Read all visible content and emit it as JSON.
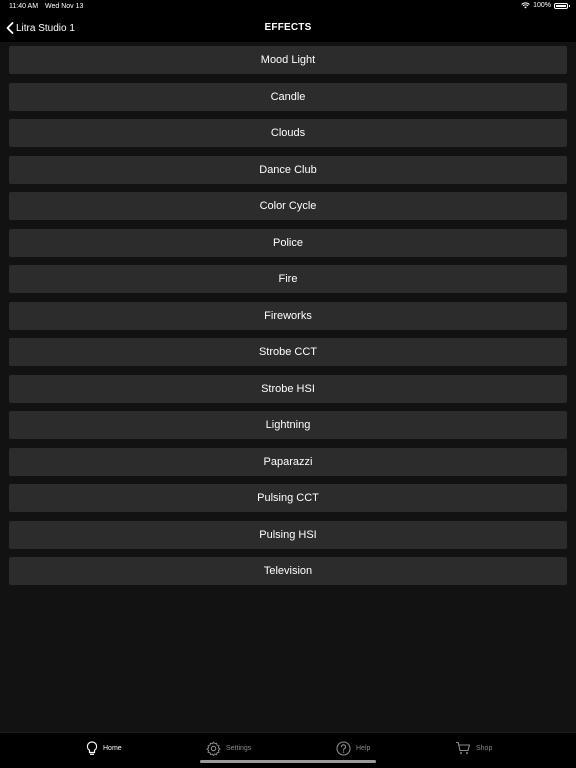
{
  "status_bar": {
    "time": "11:40 AM",
    "date": "Wed Nov 13",
    "battery": "100%",
    "battery_level": 1.0,
    "icons": [
      "wifi-icon",
      "battery-icon"
    ]
  },
  "nav": {
    "back_label": "Litra Studio 1",
    "title": "EFFECTS",
    "icons": [
      "chevron-left-icon"
    ]
  },
  "effects": [
    {
      "label": "Mood Light"
    },
    {
      "label": "Candle"
    },
    {
      "label": "Clouds"
    },
    {
      "label": "Dance Club"
    },
    {
      "label": "Color Cycle"
    },
    {
      "label": "Police"
    },
    {
      "label": "Fire"
    },
    {
      "label": "Fireworks"
    },
    {
      "label": "Strobe CCT"
    },
    {
      "label": "Strobe HSI"
    },
    {
      "label": "Lightning"
    },
    {
      "label": "Paparazzi"
    },
    {
      "label": "Pulsing CCT"
    },
    {
      "label": "Pulsing HSI"
    },
    {
      "label": "Television"
    }
  ],
  "tab_bar": {
    "home": {
      "label": "Home",
      "icon": "lightbulb-icon"
    },
    "settings": {
      "label": "Settings",
      "icon": "gear-icon"
    },
    "help": {
      "label": "Help",
      "icon": "question-circle-icon"
    },
    "shop": {
      "label": "Shop",
      "icon": "cart-icon"
    },
    "active_color": "#ffffff",
    "inactive_color": "#8a8a8a"
  },
  "colors": {
    "background": "#121212",
    "button": "#2c2c2c",
    "bar": "#000000"
  }
}
